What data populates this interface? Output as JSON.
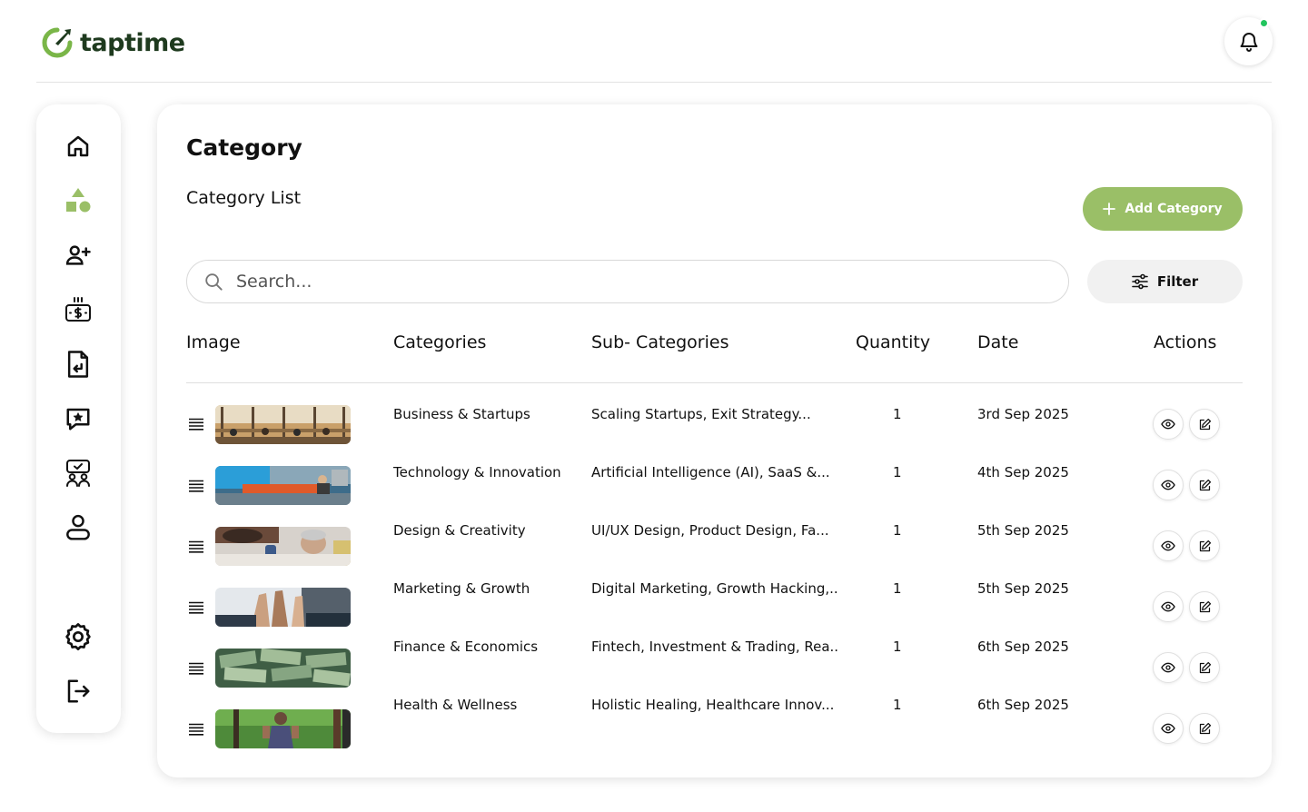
{
  "brand": {
    "name": "taptime",
    "accent": "#9abf67",
    "logo_green": "#7ab648",
    "notify_dot": "#22c55e"
  },
  "header": {
    "notification_icon": "bell-icon"
  },
  "sidebar": {
    "items": [
      {
        "icon": "home-icon",
        "label": "Home"
      },
      {
        "icon": "shapes-icon",
        "label": "Category",
        "active": true
      },
      {
        "icon": "add-user-icon",
        "label": "Add User"
      },
      {
        "icon": "payments-icon",
        "label": "Payments"
      },
      {
        "icon": "document-return-icon",
        "label": "Returns"
      },
      {
        "icon": "review-star-icon",
        "label": "Reviews"
      },
      {
        "icon": "team-check-icon",
        "label": "Teams"
      },
      {
        "icon": "profile-icon",
        "label": "Profile"
      },
      {
        "icon": "gear-icon",
        "label": "Settings"
      },
      {
        "icon": "logout-icon",
        "label": "Logout"
      }
    ]
  },
  "main": {
    "title": "Category",
    "subtitle": "Category List",
    "add_button": "Add Category",
    "search_placeholder": "Search...",
    "filter_button": "Filter",
    "columns": [
      "Image",
      "Categories",
      "Sub- Categories",
      "Quantity",
      "Date",
      "Actions"
    ],
    "rows": [
      {
        "image": "office-meeting-photo",
        "category": "Business & Startups",
        "subcategories": "Scaling Startups, Exit Strategy...",
        "quantity": "1",
        "date": "3rd Sep 2025"
      },
      {
        "image": "tech-workspace-photo",
        "category": "Technology & Innovation",
        "subcategories": "Artificial Intelligence (AI), SaaS &...",
        "quantity": "1",
        "date": "4th Sep 2025"
      },
      {
        "image": "design-team-photo",
        "category": "Design & Creativity",
        "subcategories": "UI/UX Design, Product Design, Fa...",
        "quantity": "1",
        "date": "5th Sep 2025"
      },
      {
        "image": "high-five-photo",
        "category": "Marketing & Growth",
        "subcategories": "Digital Marketing, Growth Hacking,..",
        "quantity": "1",
        "date": "5th Sep 2025"
      },
      {
        "image": "money-pile-photo",
        "category": "Finance & Economics",
        "subcategories": "Fintech, Investment & Trading, Rea..",
        "quantity": "1",
        "date": "6th Sep 2025"
      },
      {
        "image": "forest-runner-photo",
        "category": "Health & Wellness",
        "subcategories": "Holistic Healing, Healthcare Innov...",
        "quantity": "1",
        "date": "6th Sep 2025"
      }
    ]
  }
}
